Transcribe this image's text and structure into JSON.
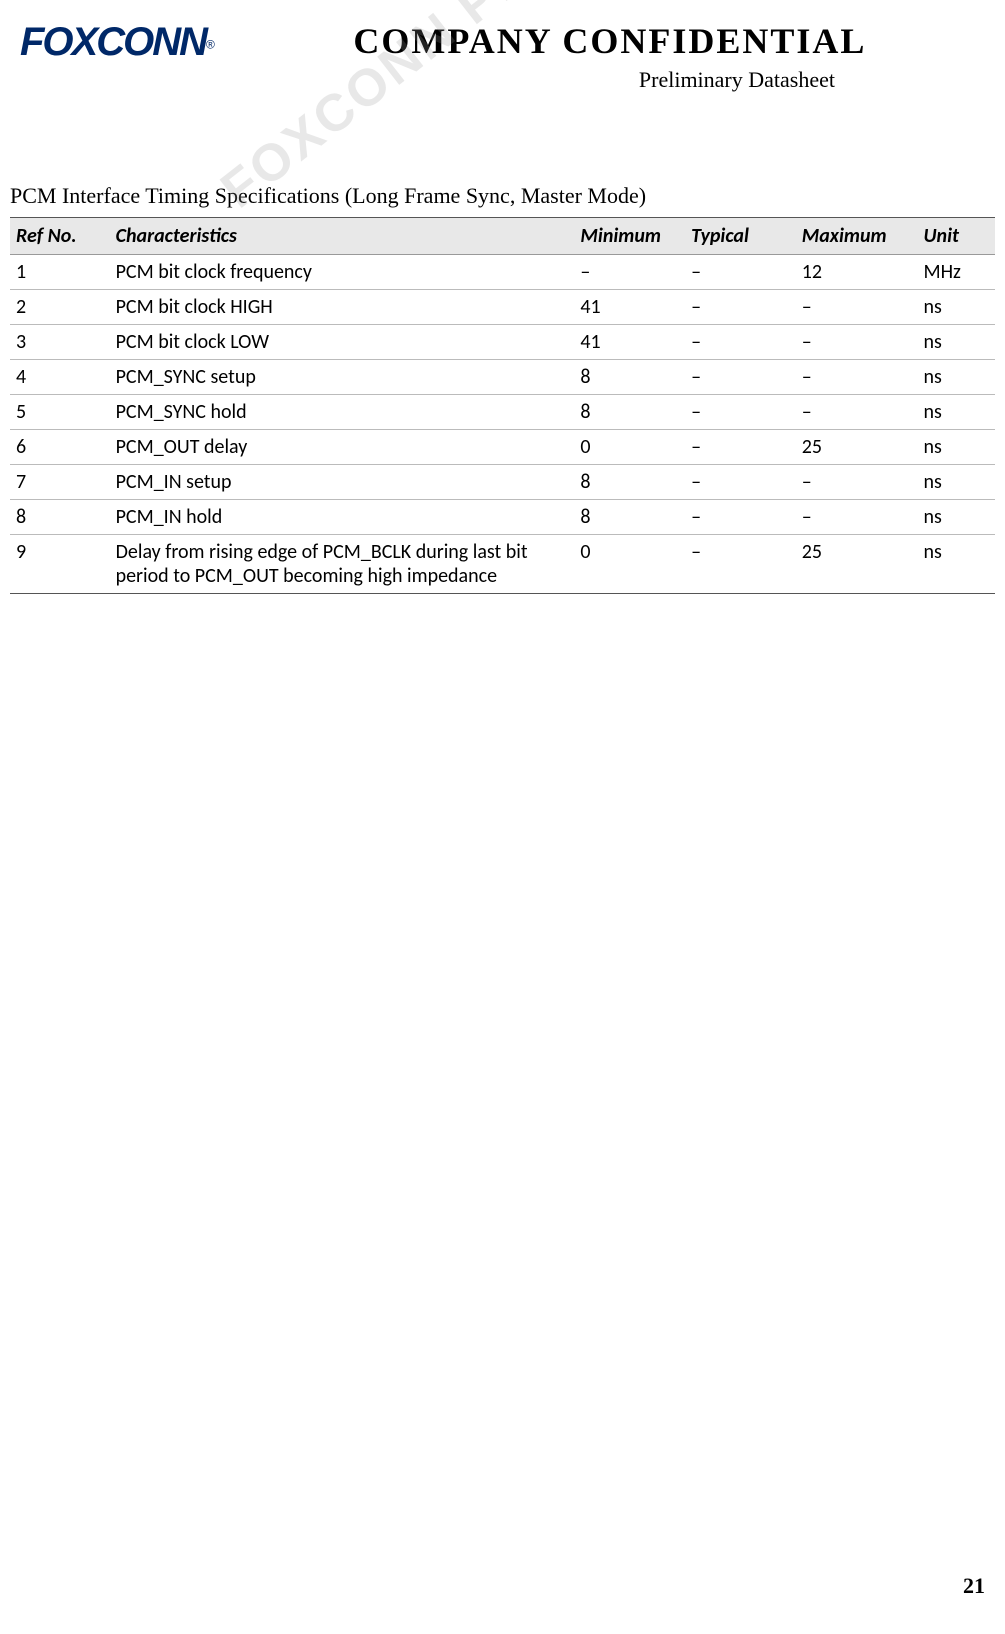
{
  "header": {
    "logo_text": "FOXCONN",
    "logo_reg": "®",
    "title_main": "COMPANY  CONFIDENTIAL",
    "title_sub": "Preliminary  Datasheet"
  },
  "watermark": "FOXCONN PRE…",
  "section_title": "PCM Interface Timing Specifications (Long Frame Sync, Master Mode)",
  "table": {
    "headers": {
      "ref": "Ref No.",
      "char": "Characteristics",
      "min": "Minimum",
      "typ": "Typical",
      "max": "Maximum",
      "unit": "Unit"
    },
    "rows": [
      {
        "ref": "1",
        "char": "PCM bit clock frequency",
        "min": "–",
        "typ": "–",
        "max": "12",
        "unit": "MHz"
      },
      {
        "ref": "2",
        "char": "PCM bit clock HIGH",
        "min": "41",
        "typ": "–",
        "max": "–",
        "unit": "ns"
      },
      {
        "ref": "3",
        "char": "PCM bit clock LOW",
        "min": "41",
        "typ": "–",
        "max": "–",
        "unit": "ns"
      },
      {
        "ref": "4",
        "char": "PCM_SYNC setup",
        "min": "8",
        "typ": "–",
        "max": "–",
        "unit": "ns"
      },
      {
        "ref": "5",
        "char": "PCM_SYNC hold",
        "min": "8",
        "typ": "–",
        "max": "–",
        "unit": "ns"
      },
      {
        "ref": "6",
        "char": "PCM_OUT delay",
        "min": "0",
        "typ": "–",
        "max": "25",
        "unit": "ns"
      },
      {
        "ref": "7",
        "char": "PCM_IN setup",
        "min": "8",
        "typ": "–",
        "max": "–",
        "unit": "ns"
      },
      {
        "ref": "8",
        "char": "PCM_IN hold",
        "min": "8",
        "typ": "–",
        "max": "–",
        "unit": "ns"
      },
      {
        "ref": "9",
        "char": "Delay from rising edge of PCM_BCLK during last bit period to PCM_OUT becoming high impedance",
        "min": "0",
        "typ": "–",
        "max": "25",
        "unit": "ns"
      }
    ]
  },
  "page_number": "21"
}
